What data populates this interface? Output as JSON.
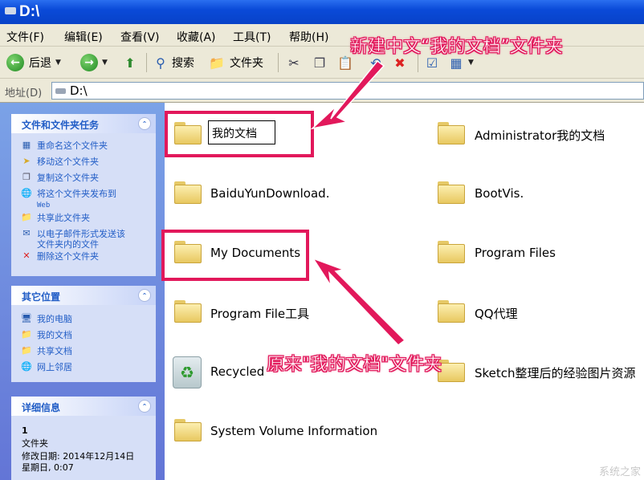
{
  "window": {
    "title": "D:\\"
  },
  "menu": [
    "文件(F)",
    "编辑(E)",
    "查看(V)",
    "收藏(A)",
    "工具(T)",
    "帮助(H)"
  ],
  "toolbar": {
    "back_label": "后退",
    "search_label": "搜索",
    "folders_label": "文件夹"
  },
  "address": {
    "label": "地址(D)",
    "path": "D:\\"
  },
  "panels": {
    "tasks": {
      "title": "文件和文件夹任务",
      "items": [
        {
          "icon": "rename-icon",
          "label": "重命名这个文件夹"
        },
        {
          "icon": "move-icon",
          "label": "移动这个文件夹"
        },
        {
          "icon": "copy-icon",
          "label": "复制这个文件夹"
        },
        {
          "icon": "publish-icon",
          "label": "将这个文件夹发布到",
          "label2": "Web"
        },
        {
          "icon": "share-icon",
          "label": "共享此文件夹"
        },
        {
          "icon": "email-icon",
          "label": "以电子邮件形式发送该",
          "label2": "文件夹内的文件"
        },
        {
          "icon": "delete-icon",
          "label": "删除这个文件夹"
        }
      ]
    },
    "places": {
      "title": "其它位置",
      "items": [
        {
          "icon": "computer-icon",
          "label": "我的电脑"
        },
        {
          "icon": "documents-icon",
          "label": "我的文档"
        },
        {
          "icon": "shared-folder-icon",
          "label": "共享文档"
        },
        {
          "icon": "network-icon",
          "label": "网上邻居"
        }
      ]
    },
    "details": {
      "title": "详细信息",
      "name": "1",
      "type": "文件夹",
      "modified_label": "修改日期: 2014年12月14日",
      "modified_time": "星期日, 0:07"
    }
  },
  "files": [
    {
      "name": "我的文档",
      "renaming": true
    },
    {
      "name": "Administrator我的文档"
    },
    {
      "name": "BaiduYunDownload."
    },
    {
      "name": "BootVis."
    },
    {
      "name": "My Documents"
    },
    {
      "name": "Program Files"
    },
    {
      "name": "Program File工具"
    },
    {
      "name": "QQ代理"
    },
    {
      "name": "Recycled",
      "icon": "recycle-bin-icon"
    },
    {
      "name": "Sketch整理后的经验图片资源"
    },
    {
      "name": "System Volume Information"
    }
  ],
  "annotations": {
    "top": "新建中文“我的文档”文件夹",
    "middle": "原来\"我的文档\"文件夹"
  },
  "watermark": "系统之家",
  "colors": {
    "highlight": "#e2185b",
    "title_bar": "#0a4ad8",
    "task_pane": "#6f8ddc"
  }
}
